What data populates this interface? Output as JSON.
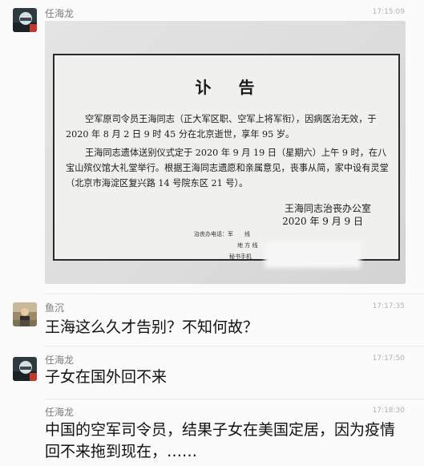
{
  "messages": [
    {
      "sender": "任海龙",
      "time": "17:15:09",
      "avatar": "helmet-avatar",
      "type": "image",
      "notice": {
        "title": "讣告",
        "para1": "空军原司令员王海同志（正大军区职、空军上将军衔），因病医治无效，于 2020 年 8 月 2 日 9 时 45 分在北京逝世，享年 95 岁。",
        "para2": "王海同志遗体送别仪式定于 2020 年 9 月 19 日（星期六）上午 9 时，在八宝山殡仪馆大礼堂举行。根据王海同志遗愿和亲属意见，丧事从简，家中设有灵堂（北京市海淀区复兴路 14 号院东区 21 号）。",
        "sign1": "王海同志治丧办公室",
        "sign2": "2020 年 9 月 9 日",
        "contact1": "治丧办电话：军　　线",
        "contact2": "地 方 线",
        "contact3": "秘书手机"
      }
    },
    {
      "sender": "鱼沉",
      "time": "17:17:35",
      "avatar": "person-avatar",
      "type": "text",
      "text": "王海这么久才告别？不知何故？"
    },
    {
      "sender": "任海龙",
      "time": "17:17:50",
      "avatar": "helmet-avatar",
      "type": "text",
      "text": "子女在国外回不来"
    },
    {
      "sender": "任海龙",
      "time": "17:18:30",
      "avatar": "none",
      "type": "text",
      "text": "中国的空军司令员，结果子女在美国定居，因为疫情回不来拖到现在，……"
    }
  ]
}
